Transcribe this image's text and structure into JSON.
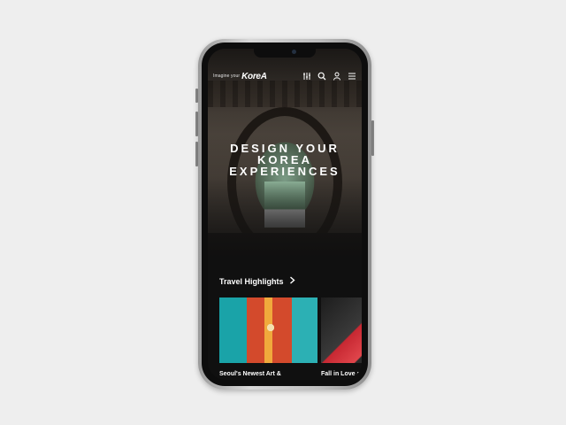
{
  "header": {
    "tagline": "Imagine your",
    "logo_text": "KoreA"
  },
  "icons": [
    "filter-icon",
    "search-icon",
    "user-icon",
    "menu-icon"
  ],
  "hero": {
    "title_line1": "DESIGN YOUR",
    "title_line2": "KOREA",
    "title_line3": "EXPERIENCES"
  },
  "highlights": {
    "section_title": "Travel Highlights",
    "cards": [
      {
        "caption": "Seoul's Newest Art &\nCulture Attractions"
      },
      {
        "caption": "Fall in Love a\nDessert Cafe"
      }
    ]
  },
  "colors": {
    "background": "#eeeeee",
    "screen": "#101010",
    "accent": "#e2262d",
    "text": "#ffffff"
  }
}
